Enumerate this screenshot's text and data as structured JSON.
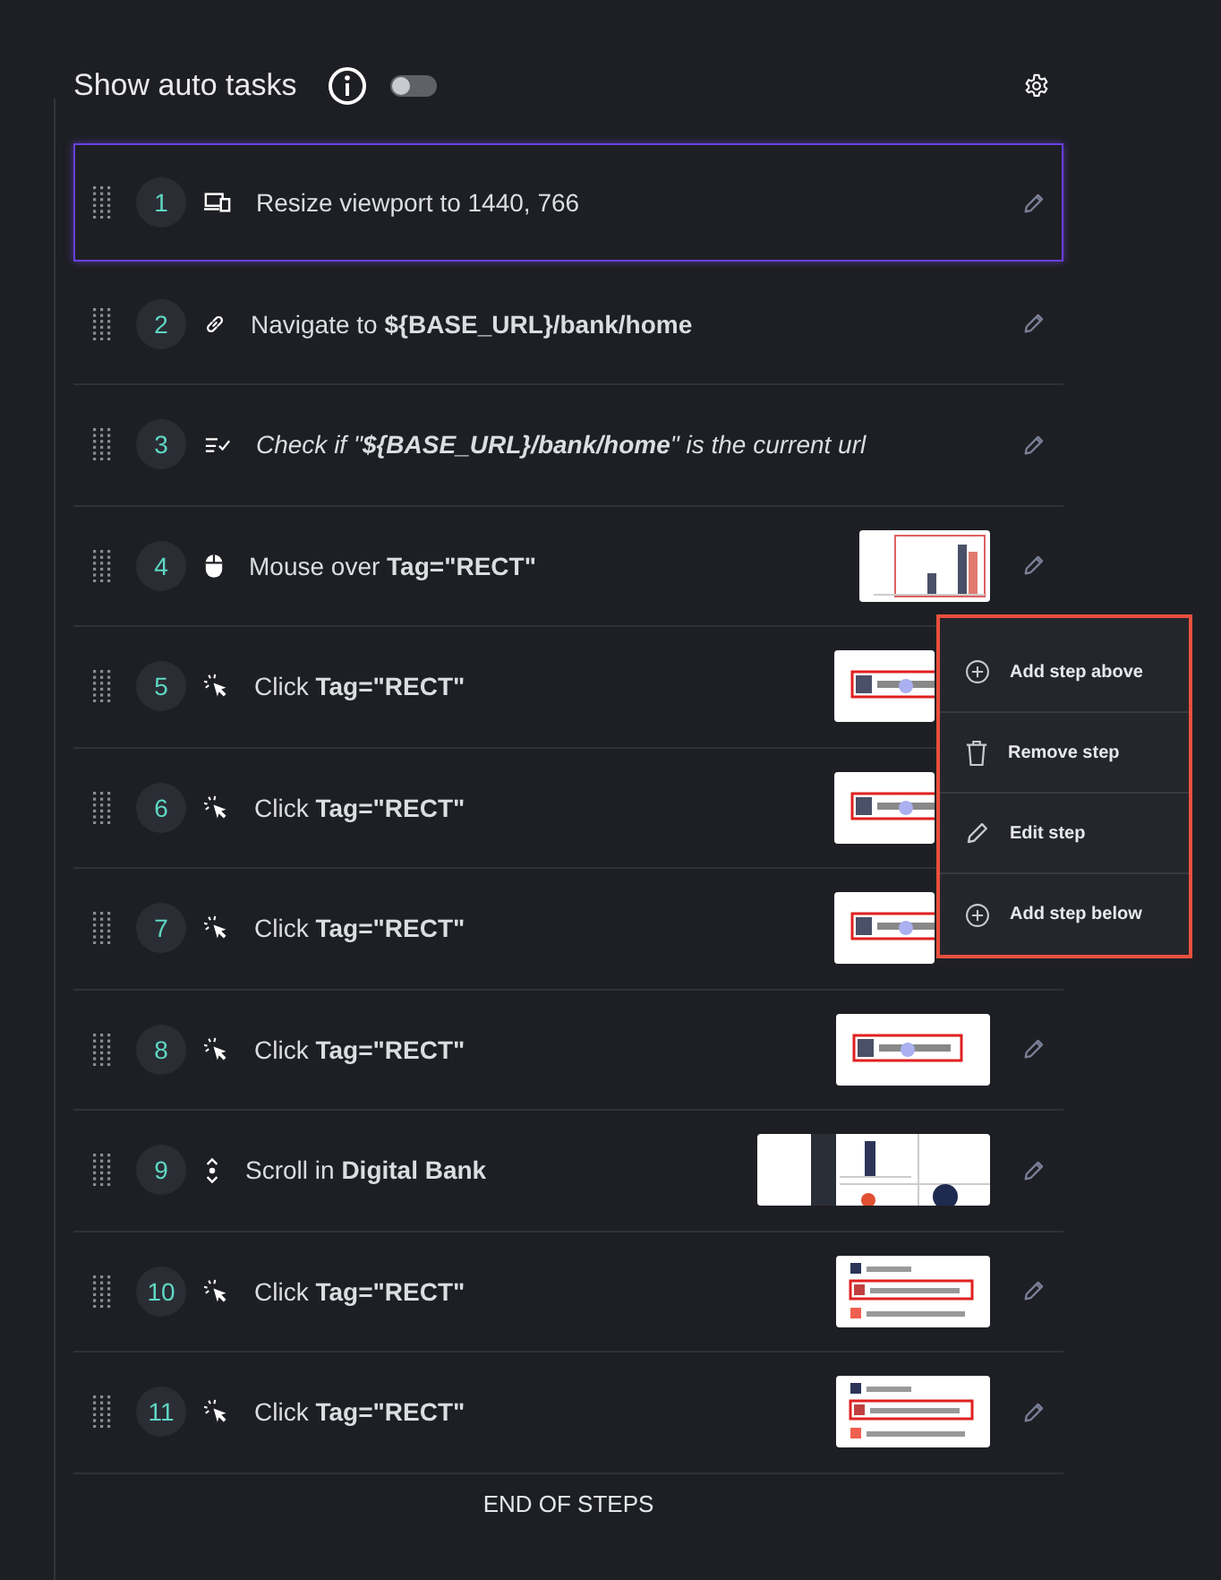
{
  "header": {
    "title": "Show auto tasks",
    "auto_tasks_on": false
  },
  "steps": [
    {
      "number": "1",
      "kind": "resize",
      "text": "Resize viewport to 1440, 766",
      "selected": true,
      "edit_visible": true
    },
    {
      "number": "2",
      "kind": "navigate",
      "text": "Navigate to **${BASE_URL}/bank/home**",
      "selected": false,
      "edit_visible": true
    },
    {
      "number": "3",
      "kind": "assert",
      "text": "Check if \"**${BASE_URL}/bank/home**\" is the current url",
      "selected": false,
      "edit_visible": true
    },
    {
      "number": "4",
      "kind": "hover",
      "text": "Mouse over **Tag=\"RECT\"**",
      "selected": false,
      "thumbnail": {
        "kind": "chart"
      },
      "edit_visible": true
    },
    {
      "number": "5",
      "kind": "click",
      "text": "Click **Tag=\"RECT\"**",
      "selected": false,
      "thumbnail": {
        "kind": "element"
      },
      "edit_visible": false
    },
    {
      "number": "6",
      "kind": "click",
      "text": "Click **Tag=\"RECT\"**",
      "selected": false,
      "thumbnail": {
        "kind": "element"
      },
      "edit_visible": false
    },
    {
      "number": "7",
      "kind": "click",
      "text": "Click **Tag=\"RECT\"**",
      "selected": false,
      "thumbnail": {
        "kind": "element"
      },
      "edit_visible": false
    },
    {
      "number": "8",
      "kind": "click",
      "text": "Click **Tag=\"RECT\"**",
      "selected": false,
      "thumbnail": {
        "kind": "element"
      },
      "edit_visible": true
    },
    {
      "number": "9",
      "kind": "scroll",
      "text": "Scroll in **Digital Bank**",
      "selected": false,
      "thumbnail": {
        "kind": "page"
      },
      "edit_visible": true
    },
    {
      "number": "10",
      "kind": "click",
      "text": "Click **Tag=\"RECT\"**",
      "selected": false,
      "thumbnail": {
        "kind": "legend"
      },
      "edit_visible": true
    },
    {
      "number": "11",
      "kind": "click",
      "text": "Click **Tag=\"RECT\"**",
      "selected": false,
      "thumbnail": {
        "kind": "legend"
      },
      "edit_visible": true
    }
  ],
  "context_menu": [
    {
      "kind": "add",
      "label": "Add step above"
    },
    {
      "kind": "remove",
      "label": "Remove step"
    },
    {
      "kind": "edit",
      "label": "Edit step"
    },
    {
      "kind": "add",
      "label": "Add step below"
    }
  ],
  "footer": "END OF STEPS"
}
